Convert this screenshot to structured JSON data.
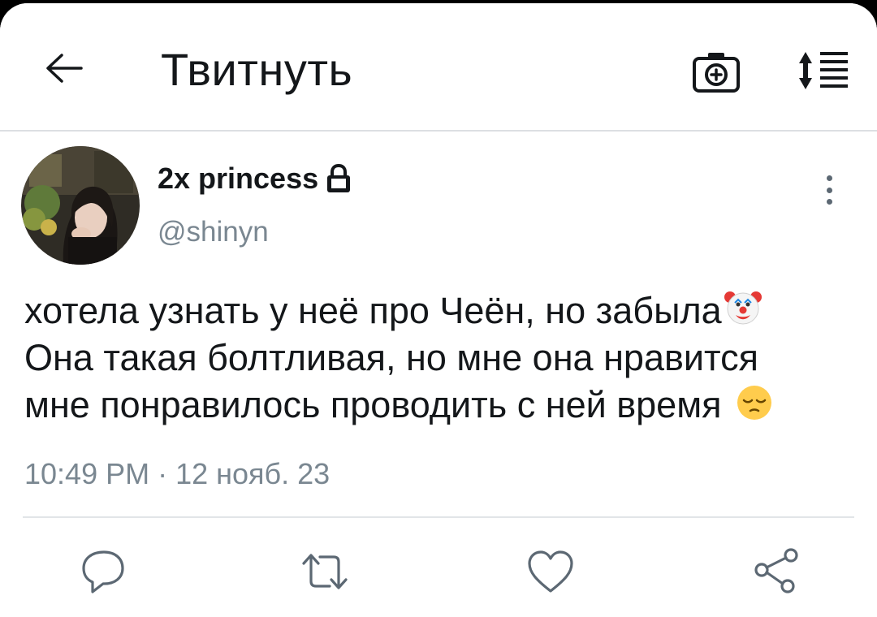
{
  "header": {
    "title": "Твитнуть",
    "back_icon": "arrow-left-icon",
    "camera_icon": "camera-add-icon",
    "sort_icon": "sort-arrows-icon"
  },
  "tweet": {
    "display_name": "2x princess",
    "protected_icon": "lock-icon",
    "handle": "@shinyn",
    "text_lines": [
      "хотела узнать у неё про Чеён, но забыла",
      "Она такая болтливая, но мне она нравится",
      "мне понравилось проводить с ней время"
    ],
    "emojis": [
      "clown-emoji",
      "pensive-emoji"
    ],
    "timestamp": "10:49 PM · 12 нояб. 23"
  },
  "actions": {
    "reply_icon": "reply-icon",
    "retweet_icon": "retweet-icon",
    "like_icon": "heart-icon",
    "share_icon": "share-icon"
  },
  "colors": {
    "text": "#14171a",
    "secondary": "#7a8791",
    "divider": "#e2e5e8",
    "icon": "#5c6873"
  }
}
